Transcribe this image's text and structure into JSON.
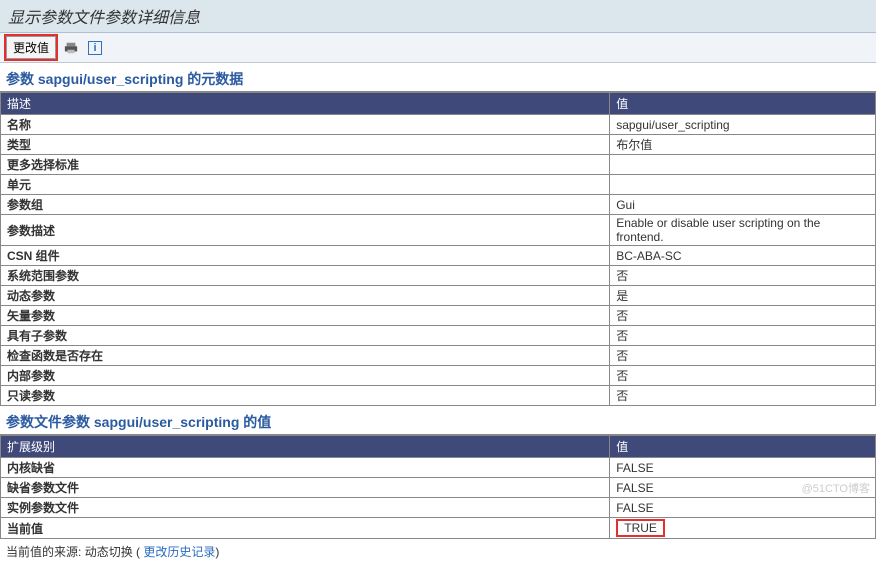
{
  "title": "显示参数文件参数详细信息",
  "toolbar": {
    "change_value": "更改值"
  },
  "section1": {
    "title": "参数 sapgui/user_scripting 的元数据",
    "header": {
      "desc": "描述",
      "val": "值"
    },
    "rows": [
      {
        "label": "名称",
        "value": "sapgui/user_scripting"
      },
      {
        "label": "类型",
        "value": "布尔值"
      },
      {
        "label": "更多选择标准",
        "value": ""
      },
      {
        "label": "单元",
        "value": ""
      },
      {
        "label": "参数组",
        "value": "Gui"
      },
      {
        "label": "参数描述",
        "value": "Enable or disable user scripting on the frontend."
      },
      {
        "label": "CSN 组件",
        "value": "BC-ABA-SC"
      },
      {
        "label": "系统范围参数",
        "value": "否"
      },
      {
        "label": "动态参数",
        "value": "是"
      },
      {
        "label": "矢量参数",
        "value": "否"
      },
      {
        "label": "具有子参数",
        "value": "否"
      },
      {
        "label": "检查函数是否存在",
        "value": "否"
      },
      {
        "label": "内部参数",
        "value": "否"
      },
      {
        "label": "只读参数",
        "value": "否"
      }
    ]
  },
  "section2": {
    "title": "参数文件参数 sapgui/user_scripting 的值",
    "header": {
      "desc": "扩展级别",
      "val": "值"
    },
    "rows": [
      {
        "label": "内核缺省",
        "value": "FALSE"
      },
      {
        "label": "缺省参数文件",
        "value": "FALSE"
      },
      {
        "label": "实例参数文件",
        "value": "FALSE"
      },
      {
        "label": "当前值",
        "value": "TRUE",
        "highlight": true
      }
    ]
  },
  "footer": {
    "prefix": "当前值的来源:",
    "text": "动态切换 (",
    "link": "更改历史记录",
    "suffix": ")"
  },
  "watermark": "@51CTO博客"
}
